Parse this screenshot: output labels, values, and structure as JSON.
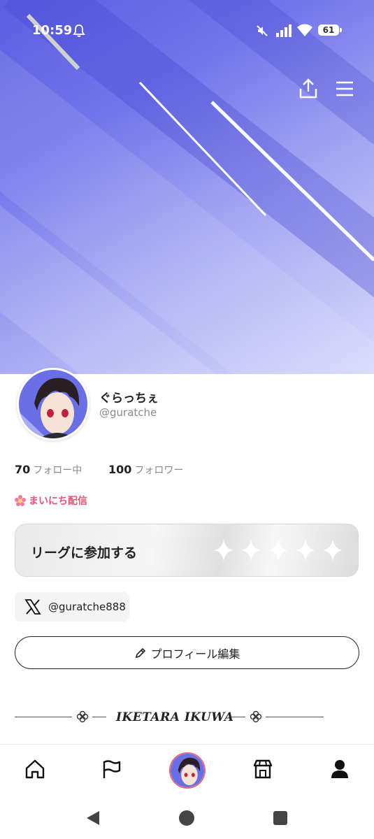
{
  "status_bar": {
    "time": "10:59",
    "battery": "61"
  },
  "header": {
    "icons": [
      "share-icon",
      "menu-icon"
    ],
    "colors": {
      "banner_start": "#5b5ee0",
      "banner_end": "#d8d9fb"
    }
  },
  "profile": {
    "display_name": "ぐらっちぇ",
    "handle": "@guratche",
    "following_count": "70",
    "following_label": "フォロー中",
    "followers_count": "100",
    "followers_label": "フォロワー",
    "badge_label": "まいにち配信",
    "badge_color": "#e8527a"
  },
  "league": {
    "label": "リーグに参加する",
    "stars": 5
  },
  "social": {
    "x_handle": "@guratche888"
  },
  "edit_profile": {
    "label": "プロフィール編集"
  },
  "section": {
    "title": "IKETARA IKUWA"
  },
  "bottom_nav": {
    "items": [
      "home-icon",
      "flag-icon",
      "avatar",
      "store-icon",
      "profile-icon"
    ]
  }
}
